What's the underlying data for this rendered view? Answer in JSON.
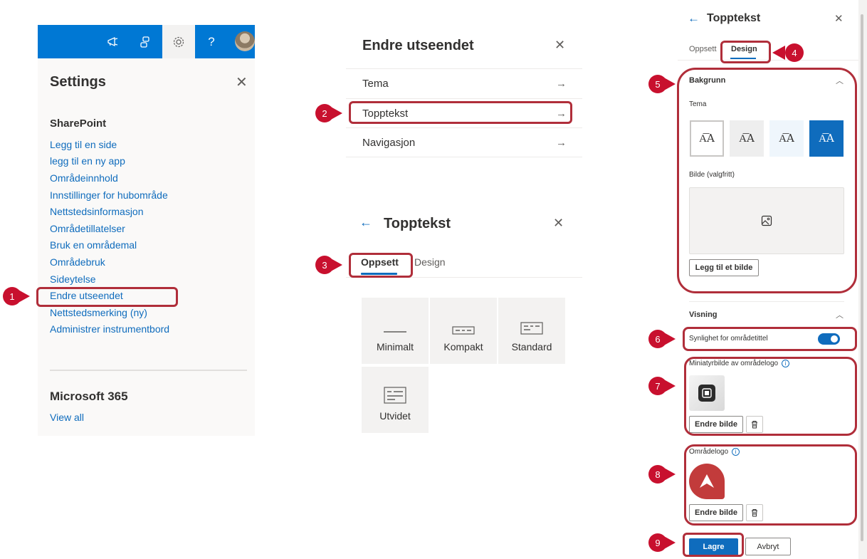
{
  "settings_panel": {
    "title": "Settings",
    "section_sharepoint": "SharePoint",
    "links": [
      "Legg til en side",
      "legg til en ny app",
      "Områdeinnhold",
      "Innstillinger for hubområde",
      "Nettstedsinformasjon",
      "Områdetillatelser",
      "Bruk en områdemal",
      "Områdebruk",
      "Sideytelse",
      "Endre utseendet",
      "Nettstedsmerking (ny)",
      "Administrer instrumentbord"
    ],
    "section_microsoft": "Microsoft 365",
    "view_all": "View all",
    "help_glyph": "?"
  },
  "change_look_panel": {
    "title": "Endre utseendet",
    "items": [
      "Tema",
      "Topptekst",
      "Navigasjon"
    ]
  },
  "header_layout_panel": {
    "title": "Topptekst",
    "tabs": [
      "Oppsett",
      "Design"
    ],
    "layouts": [
      "Minimalt",
      "Kompakt",
      "Standard",
      "Utvidet"
    ]
  },
  "header_design_panel": {
    "title": "Topptekst",
    "tabs": [
      "Oppsett",
      "Design"
    ],
    "background_heading": "Bakgrunn",
    "theme_label": "Tema",
    "theme_glyph": "A͞A",
    "image_label": "Bilde (valgfritt)",
    "add_image_button": "Legg til et bilde",
    "display_heading": "Visning",
    "site_title_visibility": "Synlighet for områdetittel",
    "thumbnail_label": "Miniatyrbilde av områdelogo",
    "change_image_button": "Endre bilde",
    "site_logo_label": "Områdelogo",
    "change_image_button_2": "Endre bilde",
    "save_button": "Lagre",
    "cancel_button": "Avbryt"
  },
  "callouts": [
    "1",
    "2",
    "3",
    "4",
    "5",
    "6",
    "7",
    "8",
    "9"
  ],
  "colors": {
    "suite_bar": "#0078d4",
    "link": "#0f6cbd",
    "primary": "#0f6cbd",
    "callout": "#c8102e",
    "callout_border": "#b02e3a"
  }
}
